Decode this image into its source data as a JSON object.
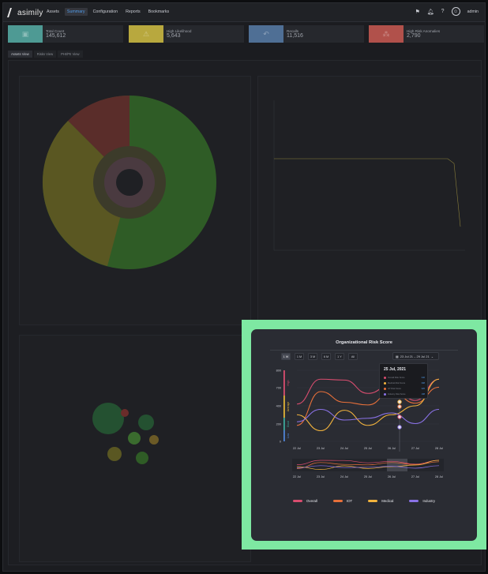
{
  "app": {
    "logo": "asimily",
    "admin": "admin"
  },
  "nav": [
    "Assets",
    "Summary",
    "Configuration",
    "Reports",
    "Bookmarks"
  ],
  "kpis": [
    {
      "label": "Total Count",
      "value": "145,612",
      "color": "#4e9a94"
    },
    {
      "label": "High Likelihood",
      "value": "5,643",
      "color": "#b8a83e"
    },
    {
      "label": "Recalls",
      "value": "11,516",
      "color": "#4f6f95"
    },
    {
      "label": "High Risk Anomalies",
      "value": "2,790",
      "color": "#b1514b"
    }
  ],
  "tabs": [
    "Assets View",
    "Risks View",
    "PHI/PII View"
  ],
  "risk_card": {
    "title": "Organizational Risk Score",
    "ranges": [
      "1 W",
      "1 M",
      "3 M",
      "6 M",
      "1 Y",
      "All"
    ],
    "date_range": "23 Jul 21 – 29 Jul 21",
    "y_ticks": [
      "800",
      "700",
      "400",
      "200",
      "0"
    ],
    "x_ticks": [
      "22 Jul",
      "23 Jul",
      "24 Jul",
      "25 Jul",
      "26 Jul",
      "27 Jul",
      "28 Jul"
    ],
    "bands": [
      {
        "label": "High",
        "color": "#d94d6f"
      },
      {
        "label": "Average",
        "color": "#e0b337"
      },
      {
        "label": "Good",
        "color": "#3da89a"
      },
      {
        "label": "Low",
        "color": "#4f84d6"
      }
    ],
    "tooltip": {
      "date": "25 Jul, 2021",
      "rows": [
        {
          "label": "Overall Risk Score",
          "value": "346",
          "color": "#d94d6f"
        },
        {
          "label": "Medical Risk Score",
          "value": "398",
          "color": "#f2b33d"
        },
        {
          "label": "IoT Risk Score",
          "value": "326",
          "color": "#e8703a"
        },
        {
          "label": "Industry Risk Score",
          "value": "198",
          "color": "#8a72e6"
        }
      ]
    },
    "legend": [
      {
        "name": "Overall",
        "color": "#d94d6f"
      },
      {
        "name": "IOT",
        "color": "#e8703a"
      },
      {
        "name": "Medical",
        "color": "#f2b33d"
      },
      {
        "name": "Industry",
        "color": "#8a72e6"
      }
    ]
  },
  "chart_data": {
    "type": "line",
    "x": [
      "22 Jul",
      "23 Jul",
      "24 Jul",
      "25 Jul",
      "26 Jul",
      "27 Jul",
      "28 Jul"
    ],
    "ylim": [
      0,
      800
    ],
    "series": [
      {
        "name": "Overall",
        "values": [
          420,
          700,
          690,
          540,
          640,
          460,
          700
        ]
      },
      {
        "name": "IOT",
        "values": [
          180,
          560,
          440,
          410,
          560,
          430,
          610
        ]
      },
      {
        "name": "Medical",
        "values": [
          300,
          120,
          350,
          180,
          300,
          400,
          700
        ]
      },
      {
        "name": "Industry",
        "values": [
          220,
          360,
          240,
          260,
          320,
          200,
          360
        ]
      }
    ]
  }
}
